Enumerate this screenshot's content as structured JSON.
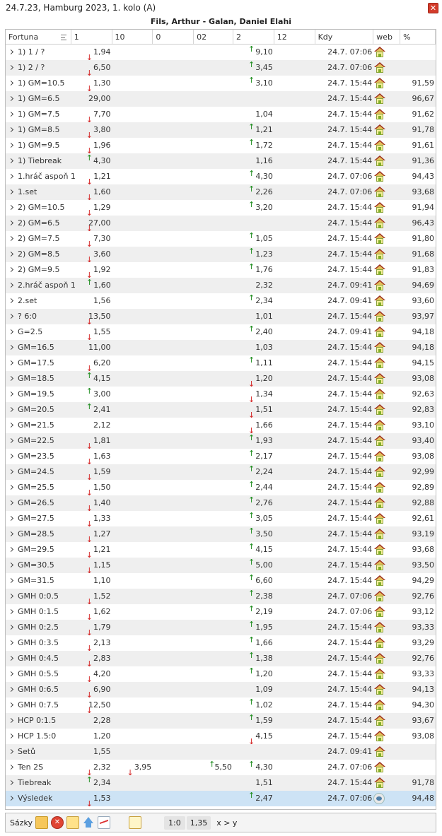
{
  "window": {
    "title": "24.7.23, Hamburg 2023, 1. kolo (A)",
    "match": "Fils, Arthur - Galan, Daniel Elahi"
  },
  "columns": [
    "Fortuna",
    "1",
    "10",
    "0",
    "02",
    "2",
    "12",
    "Kdy",
    "web",
    "%"
  ],
  "rows": [
    {
      "name": "1) 1 / ?",
      "o1": "1,94",
      "o1d": "down",
      "o2": "9,10",
      "o2d": "up",
      "kdy": "24.7. 07:06",
      "pct": ""
    },
    {
      "name": "1) 2 / ?",
      "o1": "6,50",
      "o1d": "down",
      "o2": "3,45",
      "o2d": "up",
      "kdy": "24.7. 07:06",
      "pct": ""
    },
    {
      "name": "1) GM=10.5",
      "o1": "1,30",
      "o1d": "down",
      "o2": "3,10",
      "o2d": "up",
      "kdy": "24.7. 15:44",
      "pct": "91,59"
    },
    {
      "name": "1) GM=6.5",
      "o1": "29,00",
      "o1d": "",
      "o2": "",
      "o2d": "",
      "kdy": "24.7. 15:44",
      "pct": "96,67"
    },
    {
      "name": "1) GM=7.5",
      "o1": "7,70",
      "o1d": "down",
      "o2": "1,04",
      "o2d": "",
      "kdy": "24.7. 15:44",
      "pct": "91,62"
    },
    {
      "name": "1) GM=8.5",
      "o1": "3,80",
      "o1d": "down",
      "o2": "1,21",
      "o2d": "up",
      "kdy": "24.7. 15:44",
      "pct": "91,78"
    },
    {
      "name": "1) GM=9.5",
      "o1": "1,96",
      "o1d": "down",
      "o2": "1,72",
      "o2d": "up",
      "kdy": "24.7. 15:44",
      "pct": "91,61"
    },
    {
      "name": "1) Tiebreak",
      "o1": "4,30",
      "o1d": "up",
      "o2": "1,16",
      "o2d": "",
      "kdy": "24.7. 15:44",
      "pct": "91,36"
    },
    {
      "name": "1.hráč aspoň 1",
      "o1": "1,21",
      "o1d": "down",
      "o2": "4,30",
      "o2d": "up",
      "kdy": "24.7. 07:06",
      "pct": "94,43"
    },
    {
      "name": "1.set",
      "o1": "1,60",
      "o1d": "down",
      "o2": "2,26",
      "o2d": "up",
      "kdy": "24.7. 07:06",
      "pct": "93,68"
    },
    {
      "name": "2) GM=10.5",
      "o1": "1,29",
      "o1d": "down",
      "o2": "3,20",
      "o2d": "up",
      "kdy": "24.7. 15:44",
      "pct": "91,94"
    },
    {
      "name": "2) GM=6.5",
      "o1": "27,00",
      "o1d": "down",
      "o2": "",
      "o2d": "",
      "kdy": "24.7. 15:44",
      "pct": "96,43"
    },
    {
      "name": "2) GM=7.5",
      "o1": "7,30",
      "o1d": "down",
      "o2": "1,05",
      "o2d": "up",
      "kdy": "24.7. 15:44",
      "pct": "91,80"
    },
    {
      "name": "2) GM=8.5",
      "o1": "3,60",
      "o1d": "down",
      "o2": "1,23",
      "o2d": "up",
      "kdy": "24.7. 15:44",
      "pct": "91,68"
    },
    {
      "name": "2) GM=9.5",
      "o1": "1,92",
      "o1d": "down",
      "o2": "1,76",
      "o2d": "up",
      "kdy": "24.7. 15:44",
      "pct": "91,83"
    },
    {
      "name": "2.hráč aspoň 1",
      "o1": "1,60",
      "o1d": "up",
      "o2": "2,32",
      "o2d": "",
      "kdy": "24.7. 09:41",
      "pct": "94,69"
    },
    {
      "name": "2.set",
      "o1": "1,56",
      "o1d": "",
      "o2": "2,34",
      "o2d": "up",
      "kdy": "24.7. 09:41",
      "pct": "93,60"
    },
    {
      "name": "? 6:0",
      "o1": "13,50",
      "o1d": "down",
      "o2": "1,01",
      "o2d": "",
      "kdy": "24.7. 15:44",
      "pct": "93,97"
    },
    {
      "name": "G=2.5",
      "o1": "1,55",
      "o1d": "down",
      "o2": "2,40",
      "o2d": "up",
      "kdy": "24.7. 09:41",
      "pct": "94,18"
    },
    {
      "name": "GM=16.5",
      "o1": "11,00",
      "o1d": "",
      "o2": "1,03",
      "o2d": "",
      "kdy": "24.7. 15:44",
      "pct": "94,18"
    },
    {
      "name": "GM=17.5",
      "o1": "6,20",
      "o1d": "down",
      "o2": "1,11",
      "o2d": "up",
      "kdy": "24.7. 15:44",
      "pct": "94,15"
    },
    {
      "name": "GM=18.5",
      "o1": "4,15",
      "o1d": "up",
      "o2": "1,20",
      "o2d": "down",
      "kdy": "24.7. 15:44",
      "pct": "93,08"
    },
    {
      "name": "GM=19.5",
      "o1": "3,00",
      "o1d": "up",
      "o2": "1,34",
      "o2d": "down",
      "kdy": "24.7. 15:44",
      "pct": "92,63"
    },
    {
      "name": "GM=20.5",
      "o1": "2,41",
      "o1d": "up",
      "o2": "1,51",
      "o2d": "down",
      "kdy": "24.7. 15:44",
      "pct": "92,83"
    },
    {
      "name": "GM=21.5",
      "o1": "2,12",
      "o1d": "",
      "o2": "1,66",
      "o2d": "down",
      "kdy": "24.7. 15:44",
      "pct": "93,10"
    },
    {
      "name": "GM=22.5",
      "o1": "1,81",
      "o1d": "down",
      "o2": "1,93",
      "o2d": "up",
      "kdy": "24.7. 15:44",
      "pct": "93,40"
    },
    {
      "name": "GM=23.5",
      "o1": "1,63",
      "o1d": "down",
      "o2": "2,17",
      "o2d": "up",
      "kdy": "24.7. 15:44",
      "pct": "93,08"
    },
    {
      "name": "GM=24.5",
      "o1": "1,59",
      "o1d": "down",
      "o2": "2,24",
      "o2d": "up",
      "kdy": "24.7. 15:44",
      "pct": "92,99"
    },
    {
      "name": "GM=25.5",
      "o1": "1,50",
      "o1d": "down",
      "o2": "2,44",
      "o2d": "up",
      "kdy": "24.7. 15:44",
      "pct": "92,89"
    },
    {
      "name": "GM=26.5",
      "o1": "1,40",
      "o1d": "down",
      "o2": "2,76",
      "o2d": "up",
      "kdy": "24.7. 15:44",
      "pct": "92,88"
    },
    {
      "name": "GM=27.5",
      "o1": "1,33",
      "o1d": "down",
      "o2": "3,05",
      "o2d": "up",
      "kdy": "24.7. 15:44",
      "pct": "92,61"
    },
    {
      "name": "GM=28.5",
      "o1": "1,27",
      "o1d": "down",
      "o2": "3,50",
      "o2d": "up",
      "kdy": "24.7. 15:44",
      "pct": "93,19"
    },
    {
      "name": "GM=29.5",
      "o1": "1,21",
      "o1d": "down",
      "o2": "4,15",
      "o2d": "up",
      "kdy": "24.7. 15:44",
      "pct": "93,68"
    },
    {
      "name": "GM=30.5",
      "o1": "1,15",
      "o1d": "down",
      "o2": "5,00",
      "o2d": "up",
      "kdy": "24.7. 15:44",
      "pct": "93,50"
    },
    {
      "name": "GM=31.5",
      "o1": "1,10",
      "o1d": "",
      "o2": "6,60",
      "o2d": "up",
      "kdy": "24.7. 15:44",
      "pct": "94,29"
    },
    {
      "name": "GMH 0:0.5",
      "o1": "1,52",
      "o1d": "down",
      "o2": "2,38",
      "o2d": "up",
      "kdy": "24.7. 07:06",
      "pct": "92,76"
    },
    {
      "name": "GMH 0:1.5",
      "o1": "1,62",
      "o1d": "down",
      "o2": "2,19",
      "o2d": "up",
      "kdy": "24.7. 07:06",
      "pct": "93,12"
    },
    {
      "name": "GMH 0:2.5",
      "o1": "1,79",
      "o1d": "down",
      "o2": "1,95",
      "o2d": "up",
      "kdy": "24.7. 15:44",
      "pct": "93,33"
    },
    {
      "name": "GMH 0:3.5",
      "o1": "2,13",
      "o1d": "down",
      "o2": "1,66",
      "o2d": "up",
      "kdy": "24.7. 15:44",
      "pct": "93,29"
    },
    {
      "name": "GMH 0:4.5",
      "o1": "2,83",
      "o1d": "down",
      "o2": "1,38",
      "o2d": "up",
      "kdy": "24.7. 15:44",
      "pct": "92,76"
    },
    {
      "name": "GMH 0:5.5",
      "o1": "4,20",
      "o1d": "down",
      "o2": "1,20",
      "o2d": "up",
      "kdy": "24.7. 15:44",
      "pct": "93,33"
    },
    {
      "name": "GMH 0:6.5",
      "o1": "6,90",
      "o1d": "down",
      "o2": "1,09",
      "o2d": "",
      "kdy": "24.7. 15:44",
      "pct": "94,13"
    },
    {
      "name": "GMH 0:7.5",
      "o1": "12,50",
      "o1d": "down",
      "o2": "1,02",
      "o2d": "up",
      "kdy": "24.7. 15:44",
      "pct": "94,30"
    },
    {
      "name": "HCP 0:1.5",
      "o1": "2,28",
      "o1d": "",
      "o2": "1,59",
      "o2d": "up",
      "kdy": "24.7. 15:44",
      "pct": "93,67"
    },
    {
      "name": "HCP 1.5:0",
      "o1": "1,20",
      "o1d": "",
      "o2": "4,15",
      "o2d": "down",
      "kdy": "24.7. 15:44",
      "pct": "93,08"
    },
    {
      "name": "Setů",
      "o1": "1,55",
      "o1d": "",
      "o2": "",
      "o2d": "",
      "kdy": "24.7. 09:41",
      "pct": ""
    },
    {
      "name": "Ten 2S",
      "o1": "2,32",
      "o1d": "down",
      "o10": "3,95",
      "o10d": "down",
      "o02": "5,50",
      "o02d": "up",
      "o2": "4,30",
      "o2d": "up",
      "kdy": "24.7. 07:06",
      "pct": ""
    },
    {
      "name": "Tiebreak",
      "o1": "2,34",
      "o1d": "up",
      "o2": "1,51",
      "o2d": "",
      "kdy": "24.7. 15:44",
      "pct": "91,78"
    },
    {
      "name": "Výsledek",
      "o1": "1,53",
      "o1d": "down",
      "o2": "2,47",
      "o2d": "up",
      "kdy": "24.7. 07:06",
      "pct": "94,48",
      "web": "eye"
    }
  ],
  "footer": {
    "label": "Sázky",
    "score1": "1:0",
    "score2": "1,35",
    "xy": "x > y"
  }
}
